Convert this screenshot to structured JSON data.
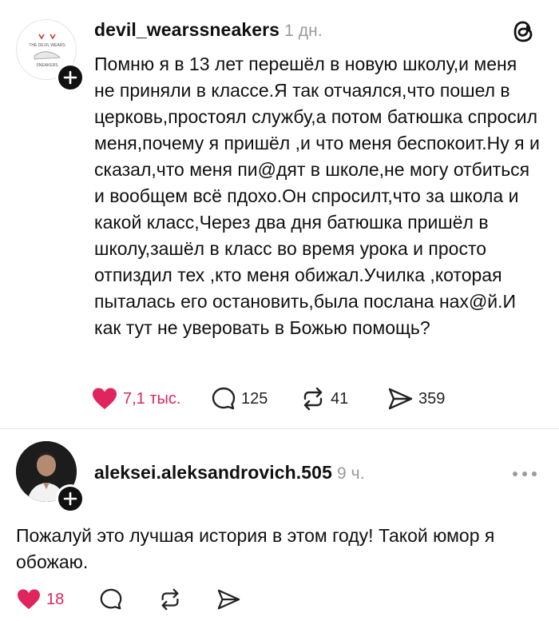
{
  "post": {
    "username": "devil_wearssneakers",
    "time": "1 дн.",
    "avatar_text_top": "THE DEVIL WEARS",
    "avatar_text_bottom": "SNEAKERS",
    "text": "Помню я в 13 лет перешёл в новую школу,и меня не приняли в классе.Я так отчаялся,что пошел в церковь,простоял службу,а потом батюшка спросил меня,почему я пришёл ,и что меня беспокоит.Ну я и сказал,что меня пи@дят в школе,не могу отбиться и вообщем всё пдохо.Он спросилт,что за школа и какой класс,Через два дня батюшка пришёл в школу,зашёл в класс во время урока и просто отпиздил тех ,кто меня обижал.Училка ,которая пыталась его остановить,была послана нах@й.И как тут не уверовать в Божью помощь?",
    "likes": "7,1 тыс.",
    "comments": "125",
    "reposts": "41",
    "shares": "359"
  },
  "reply": {
    "username": "aleksei.aleksandrovich.505",
    "time": "9 ч.",
    "text": "Пожалуй это лучшая история в этом году! Такой юмор я обожаю.",
    "likes": "18"
  },
  "colors": {
    "like_red": "#e0245e",
    "text": "#101010",
    "muted": "#9a9a9a"
  }
}
